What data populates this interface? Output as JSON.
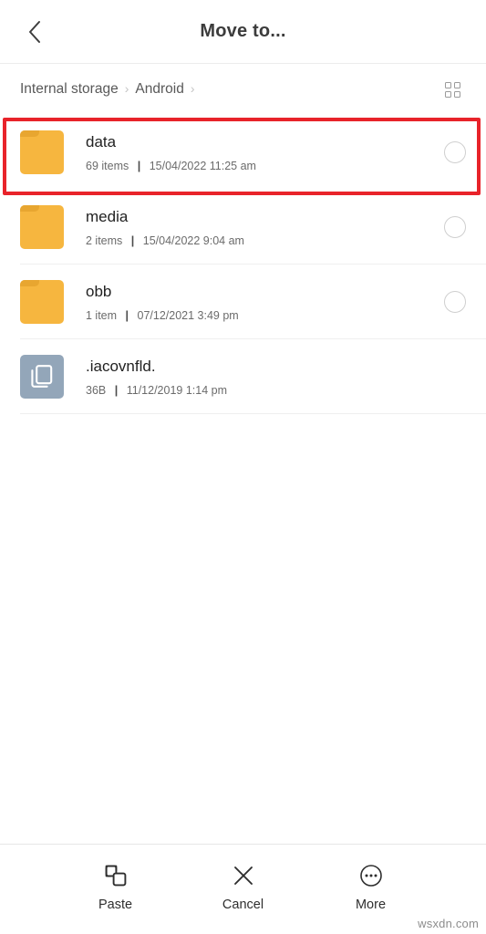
{
  "header": {
    "title": "Move to...",
    "back_icon": "chevron-left-icon"
  },
  "breadcrumb": {
    "items": [
      {
        "label": "Internal storage"
      },
      {
        "label": "Android"
      }
    ],
    "separator": "›",
    "view_toggle_icon": "grid-view-icon"
  },
  "file_list": {
    "rows": [
      {
        "name": "data",
        "count": "69 items",
        "separator": "|",
        "timestamp": "15/04/2022 11:25 am",
        "icon": "folder-icon",
        "selectable": true,
        "highlighted": true
      },
      {
        "name": "media",
        "count": "2 items",
        "separator": "|",
        "timestamp": "15/04/2022 9:04 am",
        "icon": "folder-icon",
        "selectable": true,
        "highlighted": false
      },
      {
        "name": "obb",
        "count": "1 item",
        "separator": "|",
        "timestamp": "07/12/2021 3:49 pm",
        "icon": "folder-icon",
        "selectable": true,
        "highlighted": false
      },
      {
        "name": ".iacovnfld.",
        "count": "36B",
        "separator": "|",
        "timestamp": "11/12/2019 1:14 pm",
        "icon": "file-icon",
        "selectable": false,
        "highlighted": false
      }
    ]
  },
  "bottom_bar": {
    "buttons": [
      {
        "label": "Paste",
        "icon": "paste-icon"
      },
      {
        "label": "Cancel",
        "icon": "close-x-icon"
      },
      {
        "label": "More",
        "icon": "more-circle-icon"
      }
    ]
  },
  "watermark": {
    "text": "wsxdn.com"
  },
  "colors": {
    "folder": "#F6B63F",
    "file": "#93a6b9",
    "highlight": "#e8232a",
    "title": "#3c3c3c"
  }
}
